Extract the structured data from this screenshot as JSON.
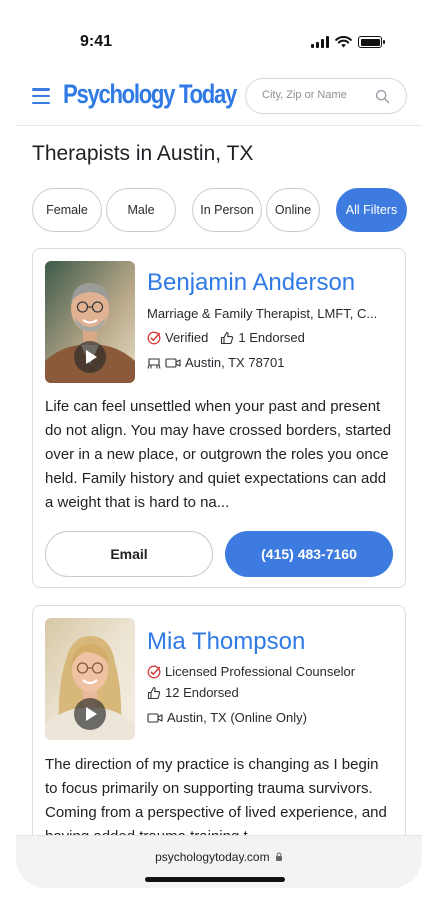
{
  "status_bar": {
    "time": "9:41"
  },
  "header": {
    "logo": "Psychology Today",
    "search_placeholder": "City, Zip or Name"
  },
  "page_title": "Therapists in Austin, TX",
  "filters": [
    {
      "label": "Female"
    },
    {
      "label": "Male"
    },
    {
      "label": "In Person"
    },
    {
      "label": "Online"
    },
    {
      "label": "All Filters"
    }
  ],
  "therapists": [
    {
      "name": "Benjamin Anderson",
      "title": "Marriage & Family Therapist, LMFT, C...",
      "verified": "Verified",
      "endorsed": "1 Endorsed",
      "location": "Austin, TX 78701",
      "bio": "Life can feel unsettled when your past and present do not align. You may have crossed borders, started over in a new place, or outgrown the roles you once held. Family history and quiet expectations can add a weight that is hard to na...",
      "email_label": "Email",
      "phone": "(415) 483-7160"
    },
    {
      "name": "Mia Thompson",
      "title": "Licensed Professional Counselor",
      "endorsed": "12 Endorsed",
      "location": "Austin, TX (Online Only)",
      "bio": "The direction of my practice is changing as I begin to focus primarily on supporting trauma survivors. Coming from a perspective of lived experience, and having added trauma training t..."
    }
  ],
  "browser": {
    "url": "psychologytoday.com"
  },
  "colors": {
    "accent": "#3d7be0",
    "verified_red": "#d93a3a"
  }
}
